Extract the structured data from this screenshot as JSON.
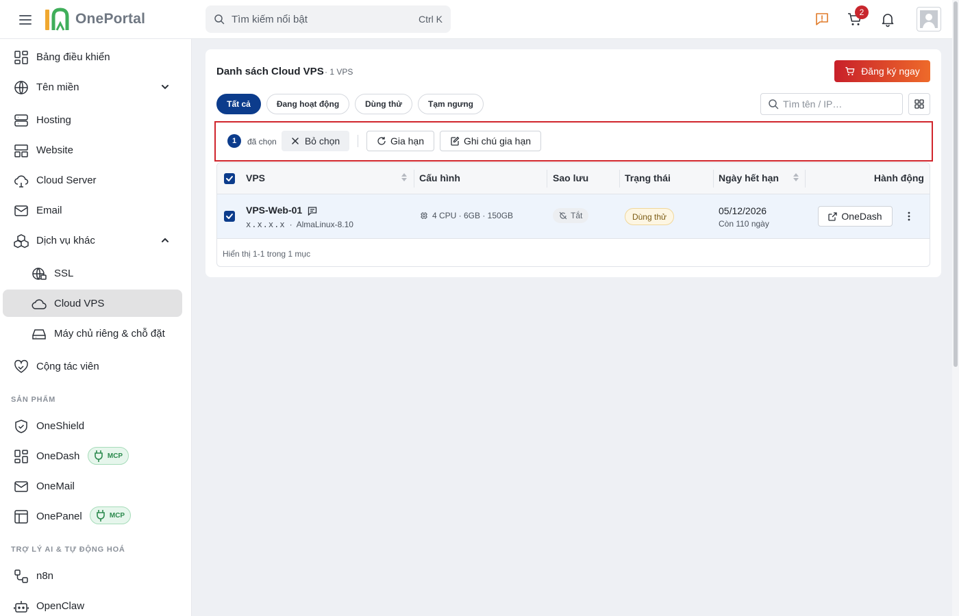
{
  "header": {
    "logo_text": "OnePortal",
    "search_placeholder": "Tìm kiếm nổi bật",
    "search_shortcut": "Ctrl K",
    "cart_count": "2",
    "accent_color": "#0c3c8c",
    "alert_color": "#c8262d"
  },
  "sidebar": {
    "items": [
      {
        "label": "Bảng điều khiển",
        "icon": "dashboard-icon"
      },
      {
        "label": "Tên miền",
        "icon": "globe-icon"
      },
      {
        "label": "Hosting",
        "icon": "server-icon"
      },
      {
        "label": "Website",
        "icon": "website-icon"
      },
      {
        "label": "Cloud Server",
        "icon": "cloud-server-icon"
      },
      {
        "label": "Email",
        "icon": "mail-icon"
      },
      {
        "label": "Dịch vụ khác",
        "icon": "boxes-icon"
      },
      {
        "label": "SSL",
        "icon": "ssl-globe-icon"
      },
      {
        "label": "Cloud VPS",
        "icon": "cloud-icon"
      },
      {
        "label": "Máy chủ riêng & chỗ đặt",
        "icon": "hard-drive-icon"
      },
      {
        "label": "Cộng tác viên",
        "icon": "handshake-heart-icon"
      }
    ],
    "section_products": "SẢN PHẨM",
    "products": [
      {
        "label": "OneShield",
        "icon": "shield-icon"
      },
      {
        "label": "OneDash",
        "icon": "dashboard-icon",
        "badge": "MCP"
      },
      {
        "label": "OneMail",
        "icon": "mail-icon"
      },
      {
        "label": "OnePanel",
        "icon": "panel-icon",
        "badge": "MCP"
      }
    ],
    "section_ai": "TRỢ LÝ AI & TỰ ĐỘNG HOÁ",
    "ai": [
      {
        "label": "n8n",
        "icon": "workflow-icon"
      },
      {
        "label": "OpenClaw",
        "icon": "bot-icon"
      }
    ]
  },
  "main": {
    "title": "Danh sách Cloud VPS",
    "count": "· 1 VPS",
    "register_button": "Đăng ký ngay",
    "filters": [
      "Tất cả",
      "Đang hoạt động",
      "Dùng thử",
      "Tạm ngưng"
    ],
    "active_filter": "Tất cả",
    "search_placeholder": "Tìm tên / IP…",
    "selection": {
      "count": "1",
      "label": "đã chọn",
      "deselect": "Bỏ chọn",
      "renew": "Gia hạn",
      "renew_note": "Ghi chú gia hạn"
    },
    "table": {
      "columns": [
        "VPS",
        "Cấu hình",
        "Sao lưu",
        "Trạng thái",
        "Ngày hết hạn",
        "Hành động"
      ],
      "rows": [
        {
          "name": "VPS-Web-01",
          "ip": "x.x.x.x",
          "os": "AlmaLinux-8.10",
          "config": "4 CPU · 6GB · 150GB",
          "backup": "Tắt",
          "status": "Dùng thử",
          "expire_date": "05/12/2026",
          "expire_left": "Còn 110 ngày",
          "action": "OneDash"
        }
      ],
      "footer": "Hiển thị 1-1 trong 1 mục"
    }
  }
}
